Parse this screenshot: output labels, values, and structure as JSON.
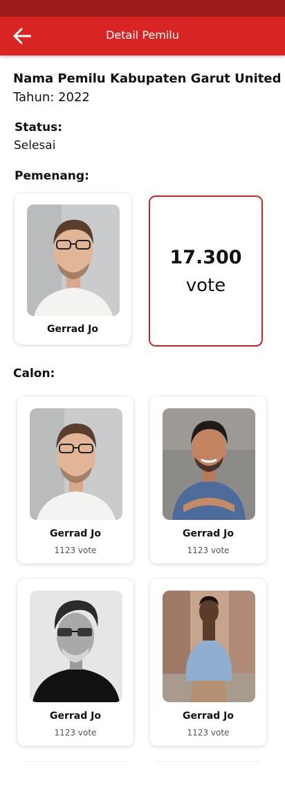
{
  "appbar": {
    "title": "Detail Pemilu",
    "back_icon": "arrow-left-icon"
  },
  "election": {
    "name": "Nama Pemilu Kabupaten Garut United",
    "year": "Tahun: 2022",
    "status_label": "Status:",
    "status_value": "Selesai",
    "winner_label": "Pemenang:"
  },
  "winner": {
    "name": "Gerrad Jo",
    "vote_count": "17.300",
    "vote_unit": "vote"
  },
  "candidates_label": "Calon:",
  "candidates": [
    {
      "name": "Gerrad Jo",
      "votes": "1123 vote"
    },
    {
      "name": "Gerrad Jo",
      "votes": "1123 vote"
    },
    {
      "name": "Gerrad Jo",
      "votes": "1123 vote"
    },
    {
      "name": "Gerrad Jo",
      "votes": "1123 vote"
    }
  ],
  "colors": {
    "primary": "#d92424",
    "status_bar": "#9e1b1b",
    "accent_border": "#c62828"
  }
}
